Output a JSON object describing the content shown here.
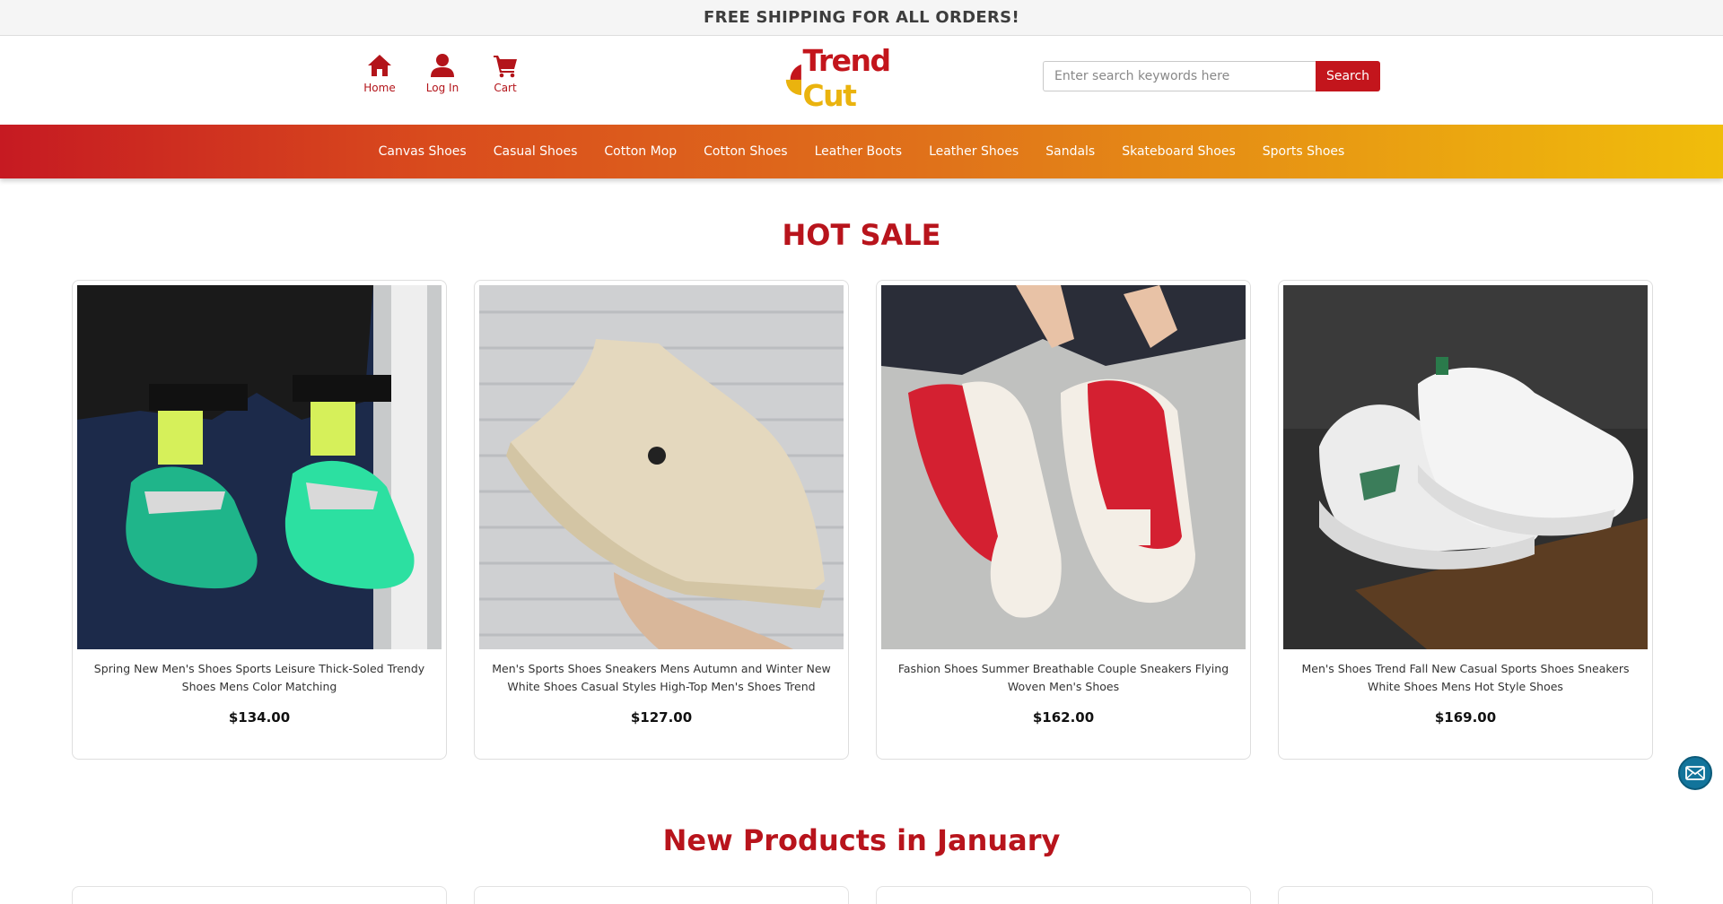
{
  "announcement": "FREE SHIPPING FOR ALL ORDERS!",
  "header": {
    "icons": [
      {
        "name": "home-icon",
        "label": "Home"
      },
      {
        "name": "user-icon",
        "label": "Log In"
      },
      {
        "name": "cart-icon",
        "label": "Cart"
      }
    ],
    "logo": {
      "part1": "Trend",
      "part2": " Cut"
    },
    "search": {
      "placeholder": "Enter search keywords here",
      "button_label": "Search"
    }
  },
  "nav": {
    "items": [
      "Canvas Shoes",
      "Casual Shoes",
      "Cotton Mop",
      "Cotton Shoes",
      "Leather Boots",
      "Leather Shoes",
      "Sandals",
      "Skateboard Shoes",
      "Sports Shoes"
    ]
  },
  "hot_sale": {
    "title": "HOT SALE",
    "products": [
      {
        "name": "Spring New Men's Shoes Sports Leisure Thick-Soled Trendy Shoes Mens Color Matching",
        "price": "$134.00"
      },
      {
        "name": "Men's Sports Shoes Sneakers Mens Autumn and Winter New White Shoes Casual Styles High-Top Men's Shoes Trend",
        "price": "$127.00"
      },
      {
        "name": "Fashion Shoes Summer Breathable Couple Sneakers Flying Woven Men's Shoes",
        "price": "$162.00"
      },
      {
        "name": "Men's Shoes Trend Fall New Casual Sports Shoes Sneakers White Shoes Mens Hot Style Shoes",
        "price": "$169.00"
      }
    ]
  },
  "new_products": {
    "title": "New Products in January"
  },
  "colors": {
    "brand_red": "#c3151c",
    "brand_yellow": "#eab30e",
    "mail_button": "#12749b"
  }
}
